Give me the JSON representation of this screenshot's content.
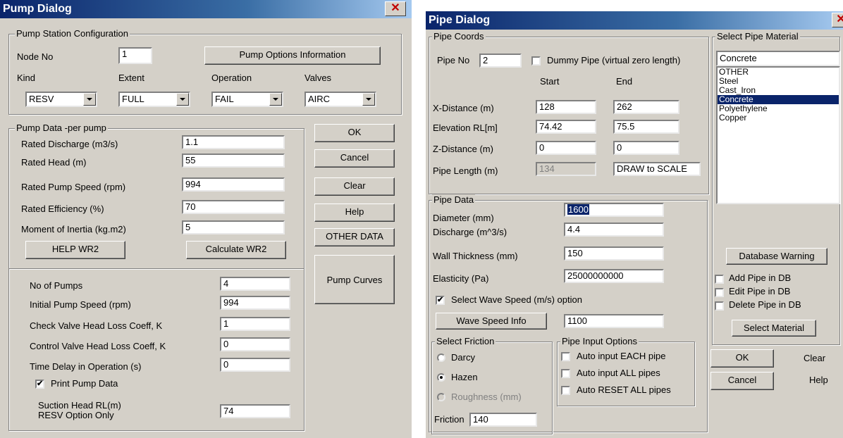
{
  "pump": {
    "title": "Pump Dialog",
    "close_glyph": "✕",
    "station": {
      "group_label": "Pump Station Configuration",
      "node_no_label": "Node No",
      "node_no_value": "1",
      "options_btn": "Pump Options Information",
      "kind_label": "Kind",
      "extent_label": "Extent",
      "operation_label": "Operation",
      "valves_label": "Valves",
      "kind_value": "RESV",
      "extent_value": "FULL",
      "operation_value": "FAIL",
      "valves_value": "AIRC"
    },
    "data": {
      "group_label": "Pump Data -per pump",
      "rated_discharge_label": "Rated Discharge (m3/s)",
      "rated_discharge_value": "1.1",
      "rated_head_label": "Rated Head (m)",
      "rated_head_value": "55",
      "rated_speed_label": "Rated Pump Speed (rpm)",
      "rated_speed_value": "994",
      "rated_eff_label": "Rated Efficiency (%)",
      "rated_eff_value": "70",
      "inertia_label": "Moment of Inertia (kg.m2)",
      "inertia_value": "5",
      "help_wr2_btn": "HELP WR2",
      "calc_wr2_btn": "Calculate WR2",
      "no_pumps_label": "No of Pumps",
      "no_pumps_value": "4",
      "init_speed_label": "Initial Pump Speed (rpm)",
      "init_speed_value": "994",
      "check_valve_label": "Check Valve Head Loss Coeff, K",
      "check_valve_value": "1",
      "control_valve_label": "Control Valve Head Loss Coeff, K",
      "control_valve_value": "0",
      "time_delay_label": "Time Delay in Operation (s)",
      "time_delay_value": "0",
      "print_label": "Print Pump Data",
      "suction_label_1": "Suction Head RL(m)",
      "suction_label_2": "RESV Option Only",
      "suction_value": "74"
    },
    "buttons": {
      "ok": "OK",
      "cancel": "Cancel",
      "clear": "Clear",
      "help": "Help",
      "other": "OTHER DATA",
      "curves": "Pump Curves"
    }
  },
  "pipe": {
    "title": "Pipe Dialog",
    "close_glyph": "✕",
    "coords": {
      "group_label": "Pipe Coords",
      "pipe_no_label": "Pipe No",
      "pipe_no_value": "2",
      "dummy_label": "Dummy Pipe (virtual zero length)",
      "start_label": "Start",
      "end_label": "End",
      "xdist_label": "X-Distance (m)",
      "xdist_start": "128",
      "xdist_end": "262",
      "elev_label": "Elevation RL[m]",
      "elev_start": "74.42",
      "elev_end": "75.5",
      "zdist_label": "Z-Distance (m)",
      "zdist_start": "0",
      "zdist_end": "0",
      "length_label": "Pipe Length (m)",
      "length_value": "134",
      "draw_scale": "DRAW to SCALE"
    },
    "data": {
      "group_label": "Pipe Data",
      "diameter_label": "Diameter (mm)",
      "diameter_value": "1600",
      "discharge_label": "Discharge (m^3/s)",
      "discharge_value": "4.4",
      "wall_label": "Wall Thickness (mm)",
      "wall_value": "150",
      "elasticity_label": "Elasticity (Pa)",
      "elasticity_value": "25000000000",
      "wave_opt_label": "Select Wave Speed (m/s) option",
      "wave_info_btn": "Wave Speed Info",
      "wave_value": "1100"
    },
    "friction": {
      "group_label": "Select Friction",
      "darcy": "Darcy",
      "hazen": "Hazen",
      "roughness": "Roughness (mm)",
      "friction_label": "Friction",
      "friction_value": "140"
    },
    "input_opts": {
      "group_label": "Pipe Input Options",
      "each": "Auto input EACH pipe",
      "all": "Auto input ALL pipes",
      "reset": "Auto RESET ALL pipes"
    },
    "material": {
      "group_label": "Select Pipe Material",
      "current": "Concrete",
      "items": [
        "OTHER",
        "Steel",
        "Cast_Iron",
        "Concrete",
        "Polyethylene",
        "Copper"
      ],
      "db_warning_btn": "Database Warning",
      "add_label": "Add Pipe in DB",
      "edit_label": "Edit Pipe in DB",
      "delete_label": "Delete Pipe in DB",
      "select_btn": "Select Material"
    },
    "buttons": {
      "ok": "OK",
      "clear": "Clear",
      "cancel": "Cancel",
      "help": "Help"
    }
  }
}
